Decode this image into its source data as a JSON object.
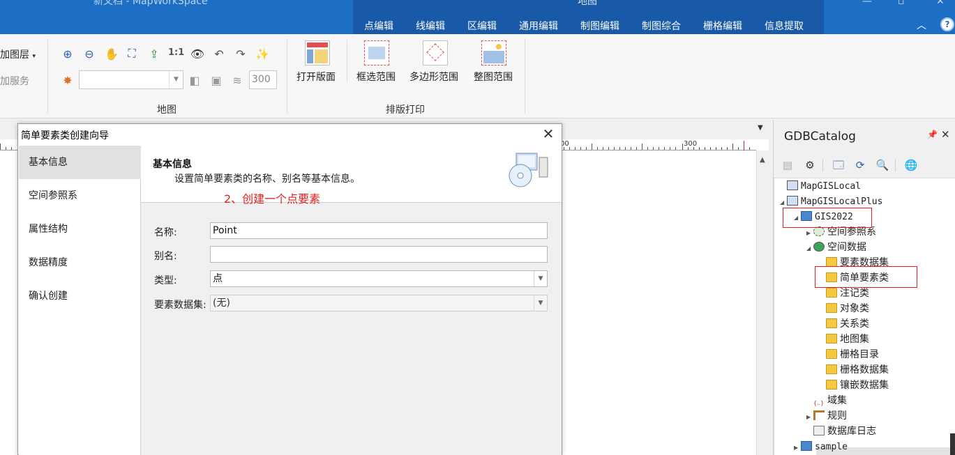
{
  "app": {
    "title": "新文档 - MapWorkSpace",
    "context_title": "地图",
    "tabs": [
      "点编辑",
      "线编辑",
      "区编辑",
      "通用编辑",
      "制图编辑",
      "制图综合",
      "栅格编辑",
      "信息提取"
    ]
  },
  "ribbon": {
    "add_layer": "加图层",
    "add_service": "加服务",
    "scale_1_1": "1:1",
    "zoom_value": "300",
    "map_group": "地图",
    "open_layout": "打开版面",
    "select_range": "框选范围",
    "polygon_range": "多边形范围",
    "whole_range": "整图范围",
    "print_group": "排版打印"
  },
  "ruler": {
    "labels": [
      "00",
      "300"
    ]
  },
  "dialog": {
    "title": "简单要素类创建向导",
    "steps": [
      "基本信息",
      "空间参照系",
      "属性结构",
      "数据精度",
      "确认创建"
    ],
    "active_step": 0,
    "header_title": "基本信息",
    "header_desc": "设置简单要素类的名称、别名等基本信息。",
    "annotation": "2、创建一个点要素",
    "fields": {
      "name_label": "名称:",
      "name_value": "Point",
      "alias_label": "别名:",
      "alias_value": "",
      "type_label": "类型:",
      "type_value": "点",
      "dataset_label": "要素数据集:",
      "dataset_value": "(无)"
    }
  },
  "catalog": {
    "title": "GDBCatalog",
    "tree": [
      {
        "label": "MapGISLocal",
        "mono": true
      },
      {
        "label": "MapGISLocalPlus",
        "mono": true
      },
      {
        "label": "GIS2022",
        "mono": true
      },
      {
        "label": "空间参照系"
      },
      {
        "label": "空间数据"
      },
      {
        "label": "要素数据集"
      },
      {
        "label": "简单要素类"
      },
      {
        "label": "注记类"
      },
      {
        "label": "对象类"
      },
      {
        "label": "关系类"
      },
      {
        "label": "地图集"
      },
      {
        "label": "栅格目录"
      },
      {
        "label": "栅格数据集"
      },
      {
        "label": "镶嵌数据集"
      },
      {
        "label": "域集"
      },
      {
        "label": "规则"
      },
      {
        "label": "数据库日志"
      },
      {
        "label": "sample",
        "mono": true
      }
    ]
  },
  "colors": {
    "title_blue": "#1c6fc4",
    "context_blue": "#1859a8",
    "annotation_red": "#e02020",
    "folder_yellow": "#f5c842"
  }
}
